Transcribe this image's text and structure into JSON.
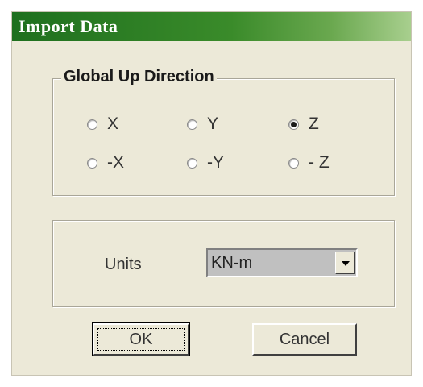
{
  "window": {
    "title": "Import Data"
  },
  "direction_group": {
    "legend": "Global Up Direction",
    "options": [
      {
        "label": "X",
        "checked": false
      },
      {
        "label": "Y",
        "checked": false
      },
      {
        "label": "Z",
        "checked": true
      },
      {
        "label": "-X",
        "checked": false
      },
      {
        "label": "-Y",
        "checked": false
      },
      {
        "label": "- Z",
        "checked": false
      }
    ]
  },
  "units_group": {
    "label": "Units",
    "selected": "KN-m"
  },
  "buttons": {
    "ok": "OK",
    "cancel": "Cancel"
  },
  "colors": {
    "titlebar_start": "#1e6f1e",
    "titlebar_end": "#a8cf8e",
    "dialog_bg": "#ece9d8"
  },
  "icons": {
    "dropdown": "chevron-down-icon"
  }
}
